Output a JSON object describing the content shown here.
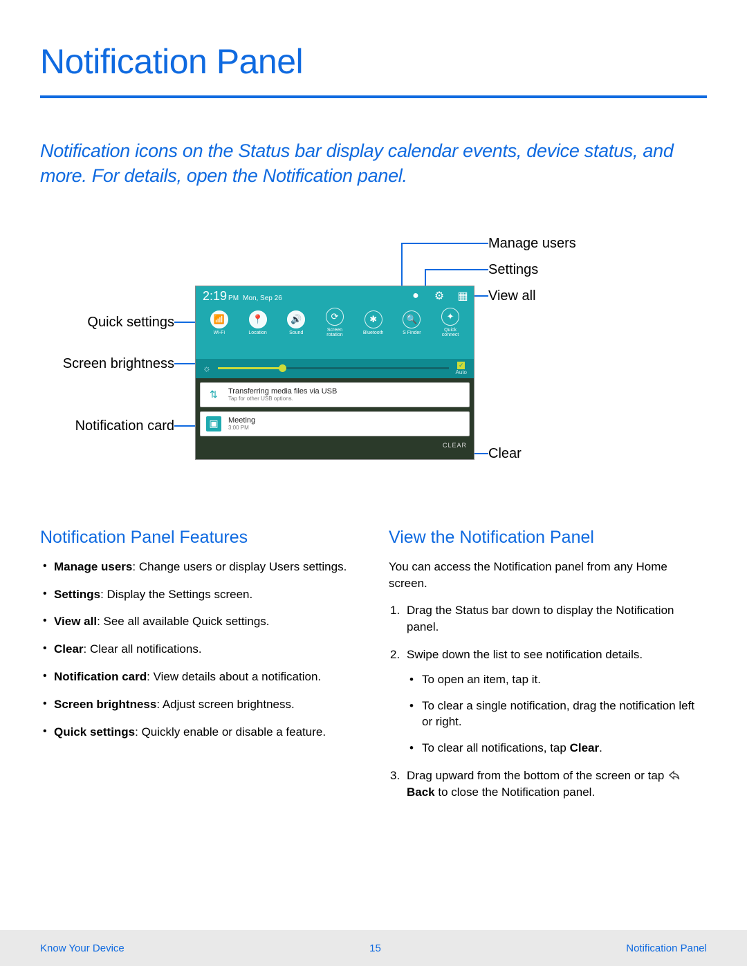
{
  "title": "Notification Panel",
  "intro": "Notification icons on the Status bar display calendar events, device status, and more. For details, open the Notification panel.",
  "callouts": {
    "manage_users": "Manage users",
    "settings": "Settings",
    "view_all": "View all",
    "quick_settings": "Quick settings",
    "screen_brightness": "Screen brightness",
    "notification_card": "Notification card",
    "clear": "Clear"
  },
  "phone": {
    "time": "2:19",
    "ampm": "PM",
    "date": "Mon, Sep 26",
    "qs": [
      {
        "label": "Wi-Fi",
        "glyph": "📶",
        "on": true
      },
      {
        "label": "Location",
        "glyph": "📍",
        "on": true
      },
      {
        "label": "Sound",
        "glyph": "🔊",
        "on": true
      },
      {
        "label": "Screen rotation",
        "glyph": "⟳",
        "on": false
      },
      {
        "label": "Bluetooth",
        "glyph": "✱",
        "on": false
      },
      {
        "label": "S Finder",
        "glyph": "🔍",
        "on": false
      },
      {
        "label": "Quick connect",
        "glyph": "✦",
        "on": false
      }
    ],
    "brightness_auto": "Auto",
    "cards": [
      {
        "icon": "usb",
        "title": "Transferring media files via USB",
        "sub": "Tap for other USB options."
      },
      {
        "icon": "cal",
        "title": "Meeting",
        "sub": "3:00 PM"
      }
    ],
    "clear_btn": "CLEAR"
  },
  "features": {
    "heading": "Notification Panel Features",
    "items": [
      {
        "bold": "Manage users",
        "text": ": Change users or display Users settings."
      },
      {
        "bold": "Settings",
        "text": ": Display the Settings screen."
      },
      {
        "bold": "View all",
        "text": ": See all available Quick settings."
      },
      {
        "bold": "Clear",
        "text": ": Clear all notifications."
      },
      {
        "bold": "Notification card",
        "text": ": View details about a notification."
      },
      {
        "bold": "Screen brightness",
        "text": ": Adjust screen brightness."
      },
      {
        "bold": "Quick settings",
        "text": ": Quickly enable or disable a feature."
      }
    ]
  },
  "view": {
    "heading": "View the Notification Panel",
    "para": "You can access the Notification panel from any Home screen.",
    "step1": "Drag the Status bar down to display the Notification panel.",
    "step2": "Swipe down the list to see notification details.",
    "sub1": "To open an item, tap it.",
    "sub2": "To clear a single notification, drag the notification left or right.",
    "sub3_pre": "To clear all notifications, tap ",
    "sub3_bold": "Clear",
    "sub3_post": ".",
    "step3_pre": "Drag upward from the bottom of the screen or tap ",
    "step3_bold": "Back",
    "step3_post": " to close the Notification panel."
  },
  "footer": {
    "left": "Know Your Device",
    "page": "15",
    "right": "Notification Panel"
  }
}
